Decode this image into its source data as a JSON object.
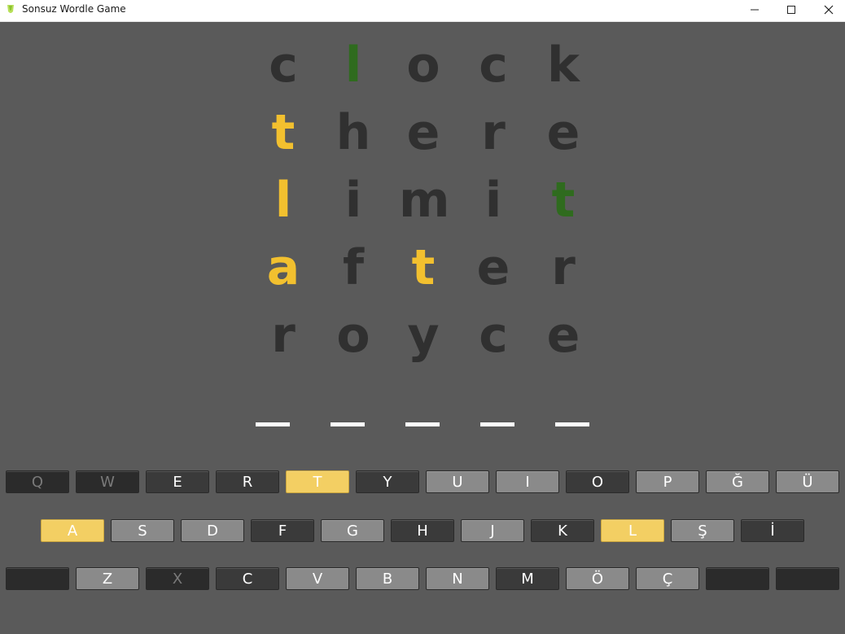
{
  "window": {
    "title": "Sonsuz Wordle Game",
    "icon": "wordle-app-icon"
  },
  "colors": {
    "background": "#5a5a5a",
    "letter_absent": "#303030",
    "letter_correct": "#2f6b1e",
    "letter_present": "#f2c02f",
    "key_unused": "#8a8a8a",
    "key_absent": "#3a3a3a",
    "key_present": "#f3cf63"
  },
  "board": {
    "rows": [
      [
        {
          "letter": "c",
          "state": "absent"
        },
        {
          "letter": "l",
          "state": "correct"
        },
        {
          "letter": "o",
          "state": "absent"
        },
        {
          "letter": "c",
          "state": "absent"
        },
        {
          "letter": "k",
          "state": "absent"
        }
      ],
      [
        {
          "letter": "t",
          "state": "present"
        },
        {
          "letter": "h",
          "state": "absent"
        },
        {
          "letter": "e",
          "state": "absent"
        },
        {
          "letter": "r",
          "state": "absent"
        },
        {
          "letter": "e",
          "state": "absent"
        }
      ],
      [
        {
          "letter": "l",
          "state": "present"
        },
        {
          "letter": "i",
          "state": "absent"
        },
        {
          "letter": "m",
          "state": "absent"
        },
        {
          "letter": "i",
          "state": "absent"
        },
        {
          "letter": "t",
          "state": "correct"
        }
      ],
      [
        {
          "letter": "a",
          "state": "present"
        },
        {
          "letter": "f",
          "state": "absent"
        },
        {
          "letter": "t",
          "state": "present"
        },
        {
          "letter": "e",
          "state": "absent"
        },
        {
          "letter": "r",
          "state": "absent"
        }
      ],
      [
        {
          "letter": "r",
          "state": "absent"
        },
        {
          "letter": "o",
          "state": "absent"
        },
        {
          "letter": "y",
          "state": "absent"
        },
        {
          "letter": "c",
          "state": "absent"
        },
        {
          "letter": "e",
          "state": "absent"
        }
      ]
    ],
    "input_slots": 5
  },
  "keyboard": {
    "rows": [
      [
        {
          "label": "Q",
          "state": "dead"
        },
        {
          "label": "W",
          "state": "dead"
        },
        {
          "label": "E",
          "state": "absent"
        },
        {
          "label": "R",
          "state": "absent"
        },
        {
          "label": "T",
          "state": "present"
        },
        {
          "label": "Y",
          "state": "absent"
        },
        {
          "label": "U",
          "state": "unused"
        },
        {
          "label": "I",
          "state": "unused"
        },
        {
          "label": "O",
          "state": "absent"
        },
        {
          "label": "P",
          "state": "unused"
        },
        {
          "label": "Ğ",
          "state": "unused"
        },
        {
          "label": "Ü",
          "state": "unused"
        }
      ],
      [
        {
          "label": "A",
          "state": "present"
        },
        {
          "label": "S",
          "state": "unused"
        },
        {
          "label": "D",
          "state": "unused"
        },
        {
          "label": "F",
          "state": "absent"
        },
        {
          "label": "G",
          "state": "unused"
        },
        {
          "label": "H",
          "state": "absent"
        },
        {
          "label": "J",
          "state": "unused"
        },
        {
          "label": "K",
          "state": "absent"
        },
        {
          "label": "L",
          "state": "present"
        },
        {
          "label": "Ş",
          "state": "unused"
        },
        {
          "label": "İ",
          "state": "absent"
        }
      ],
      [
        {
          "label": "",
          "state": "blank"
        },
        {
          "label": "Z",
          "state": "unused"
        },
        {
          "label": "X",
          "state": "dead"
        },
        {
          "label": "C",
          "state": "absent"
        },
        {
          "label": "V",
          "state": "unused"
        },
        {
          "label": "B",
          "state": "unused"
        },
        {
          "label": "N",
          "state": "unused"
        },
        {
          "label": "M",
          "state": "absent"
        },
        {
          "label": "Ö",
          "state": "unused"
        },
        {
          "label": "Ç",
          "state": "unused"
        },
        {
          "label": "",
          "state": "blank"
        },
        {
          "label": "",
          "state": "blank"
        }
      ]
    ]
  }
}
